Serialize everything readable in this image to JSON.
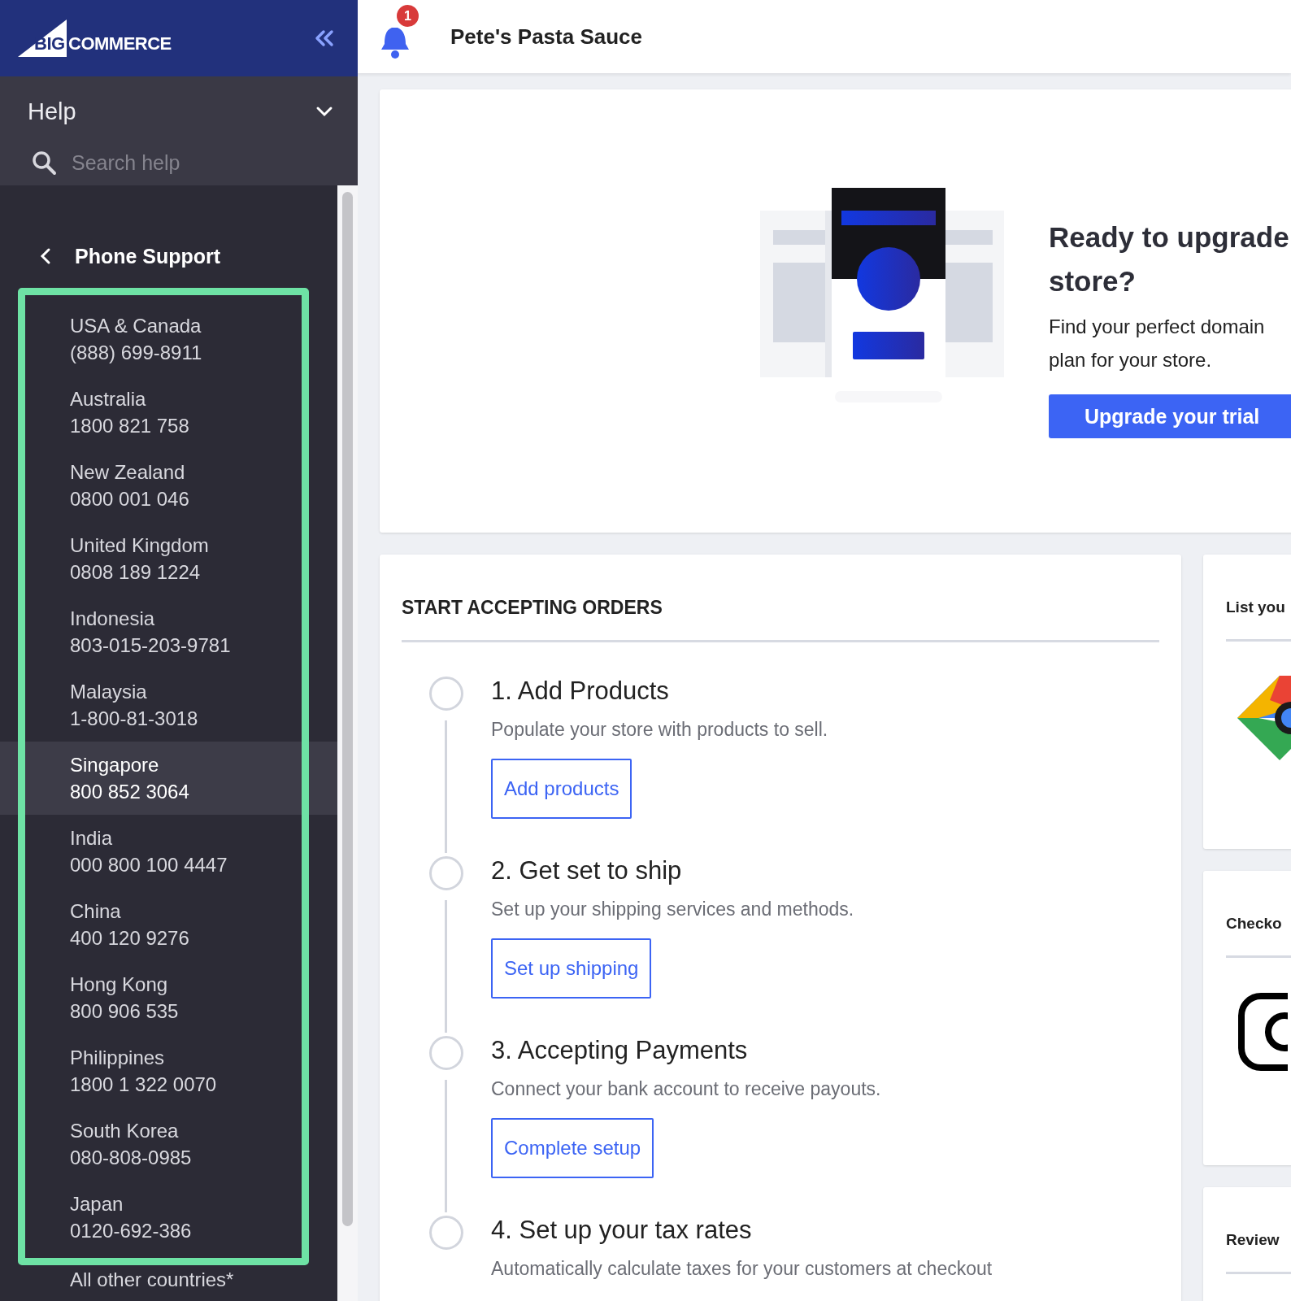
{
  "logo": {
    "part_1": "BIG",
    "part_2": "COMMERCE"
  },
  "header": {
    "notification_count": "1",
    "store_name": "Pete's Pasta Sauce"
  },
  "help": {
    "title": "Help",
    "expanded": true,
    "search": {
      "placeholder": "Search help"
    }
  },
  "phone_support": {
    "title": "Phone Support",
    "items": [
      {
        "country": "USA & Canada",
        "phone": "(888) 699-8911",
        "selected": false
      },
      {
        "country": "Australia",
        "phone": "1800 821 758",
        "selected": false
      },
      {
        "country": "New Zealand",
        "phone": "0800 001 046",
        "selected": false
      },
      {
        "country": "United Kingdom",
        "phone": "0808 189 1224",
        "selected": false
      },
      {
        "country": "Indonesia",
        "phone": "803-015-203-9781",
        "selected": false
      },
      {
        "country": "Malaysia",
        "phone": "1-800-81-3018",
        "selected": false
      },
      {
        "country": "Singapore",
        "phone": "800 852 3064",
        "selected": true
      },
      {
        "country": "India",
        "phone": "000 800 100 4447",
        "selected": false
      },
      {
        "country": "China",
        "phone": "400 120 9276",
        "selected": false
      },
      {
        "country": "Hong Kong",
        "phone": "800 906 535",
        "selected": false
      },
      {
        "country": "Philippines",
        "phone": "1800 1 322 0070",
        "selected": false
      },
      {
        "country": "South Korea",
        "phone": "080-808-0985",
        "selected": false
      },
      {
        "country": "Japan",
        "phone": "0120-692-386",
        "selected": false
      }
    ],
    "more": "All other countries*"
  },
  "upgrade": {
    "title_lines": [
      "Ready to upgrade",
      "store?"
    ],
    "text_lines": [
      "Find your perfect domain",
      "plan for your store."
    ],
    "button": "Upgrade your trial"
  },
  "orders": {
    "heading": "START ACCEPTING ORDERS",
    "steps": [
      {
        "title": "1. Add Products",
        "description": "Populate your store with products to sell.",
        "button": "Add products",
        "done": false
      },
      {
        "title": "2. Get set to ship",
        "description": "Set up your shipping services and methods.",
        "button": "Set up shipping",
        "done": false
      },
      {
        "title": "3. Accepting Payments",
        "description": "Connect your bank account to receive payouts.",
        "button": "Complete setup",
        "done": false
      },
      {
        "title": "4. Set up your tax rates",
        "description": "Automatically calculate taxes for your customers at checkout",
        "done": false
      }
    ]
  },
  "side_cards": [
    {
      "title": "List you",
      "kind": "google"
    },
    {
      "title": "Checko",
      "kind": "instagram"
    },
    {
      "title": "Review",
      "kind": "none"
    }
  ]
}
